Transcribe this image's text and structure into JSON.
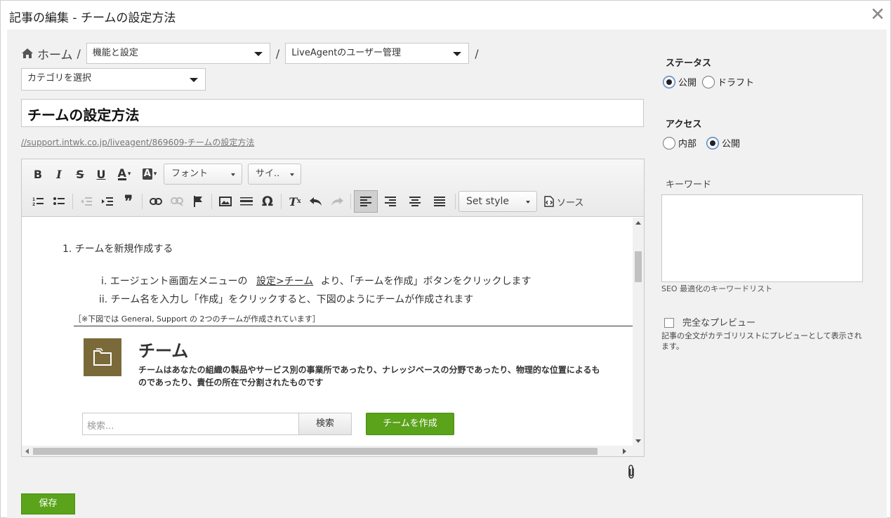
{
  "dialog": {
    "title": "記事の編集 - チームの設定方法",
    "close_glyph": "✕"
  },
  "breadcrumb": {
    "home_label": "ホーム",
    "separator": "/",
    "selects": [
      "機能と設定",
      "LiveAgentのユーザー管理",
      "カテゴリを選択"
    ]
  },
  "article": {
    "title": "チームの設定方法",
    "permalink": "//support.intwk.co.jp/liveagent/869609-チームの設定方法"
  },
  "toolbar": {
    "font_label": "フォント",
    "size_label": "サイ..",
    "style_label": "Set style",
    "source_label": "ソース",
    "row1_icons": [
      "bold-icon",
      "italic-icon",
      "strikethrough-icon",
      "underline-icon",
      "text-color-icon",
      "background-color-icon"
    ],
    "row2_icons": [
      "numbered-list-icon",
      "bulleted-list-icon",
      "outdent-icon",
      "indent-icon",
      "blockquote-icon",
      "link-icon",
      "unlink-icon",
      "anchor-flag-icon",
      "image-icon",
      "horizontal-rule-icon",
      "special-char-icon",
      "remove-format-icon",
      "undo-icon",
      "redo-icon",
      "align-left-icon",
      "align-right-icon",
      "align-center-icon",
      "align-justify-icon"
    ]
  },
  "content": {
    "step1": "1. チームを新規作成する",
    "step1_i_prefix": "i. エージェント画面左メニューの",
    "step1_i_link": "設定>チーム",
    "step1_i_suffix": "より、「チームを作成」ボタンをクリックします",
    "step1_ii": "ii. チーム名を入力し「作成」をクリックすると、下図のようにチームが作成されます",
    "note": "［※下図では General, Support の 2つのチームが作成されています］",
    "embed": {
      "title": "チーム",
      "description": "チームはあなたの組織の製品やサービス別の事業所であったり、ナレッジベースの分野であったり、物理的な位置によるものであったり、責任の所在で分割されたものです",
      "search_placeholder": "検索...",
      "search_button": "検索",
      "create_button": "チームを作成"
    }
  },
  "footer": {
    "save_label": "保存"
  },
  "sidebar": {
    "status_label": "ステータス",
    "status_options": [
      "公開",
      "ドラフト"
    ],
    "status_selected": "公開",
    "access_label": "アクセス",
    "access_options": [
      "内部",
      "公開"
    ],
    "access_selected": "公開",
    "keywords_label": "キーワード",
    "keywords_value": "",
    "keywords_hint": "SEO 最適化のキーワードリスト",
    "preview_label": "完全なプレビュー",
    "preview_desc": "記事の全文がカテゴリリストにプレビューとして表示されます。"
  },
  "colors": {
    "accent_green": "#5aa31a",
    "team_icon_bg": "#7a6a3a"
  }
}
